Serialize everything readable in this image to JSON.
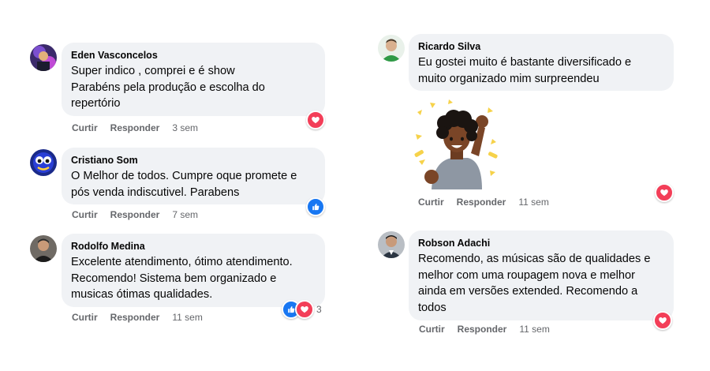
{
  "left_column": [
    {
      "author": "Eden Vasconcelos",
      "text": "Super indico , comprei e é show\nParabéns pela produção e escolha do\nrepertório",
      "actions": [
        "Curtir",
        "Responder"
      ],
      "time": "3 sem",
      "reactions": [
        "love-icon"
      ],
      "reaction_count": ""
    },
    {
      "author": "Cristiano Som",
      "text": "O Melhor de todos. Cumpre oque promete e\npós venda indiscutivel. Parabens",
      "actions": [
        "Curtir",
        "Responder"
      ],
      "time": "7 sem",
      "reactions": [
        "like-icon"
      ],
      "reaction_count": ""
    },
    {
      "author": "Rodolfo Medina",
      "text": "Excelente atendimento, ótimo atendimento.\nRecomendo! Sistema bem organizado e\nmusicas ótimas qualidades.",
      "actions": [
        "Curtir",
        "Responder"
      ],
      "time": "11 sem",
      "reactions": [
        "like-icon",
        "love-icon"
      ],
      "reaction_count": "3"
    }
  ],
  "right_column": [
    {
      "author": "Ricardo Silva",
      "text": "Eu gostei muito é bastante diversificado e\nmuito organizado mim surpreendeu",
      "actions": [
        "Curtir",
        "Responder"
      ],
      "time": "11 sem",
      "reactions": [
        "love-icon"
      ],
      "reaction_count": "",
      "sticker": "celebrating-person-sticker"
    },
    {
      "author": "Robson Adachi",
      "text": "Recomendo, as músicas são de qualidades e\nmelhor com uma roupagem nova e melhor\nainda em versões extended. Recomendo a\ntodos",
      "actions": [
        "Curtir",
        "Responder"
      ],
      "time": "11 sem",
      "reactions": [
        "love-icon"
      ],
      "reaction_count": ""
    }
  ],
  "colors": {
    "bubble": "#f0f2f5",
    "meta_text": "#65676b",
    "love": "#f33e58",
    "like": "#1877f2"
  }
}
